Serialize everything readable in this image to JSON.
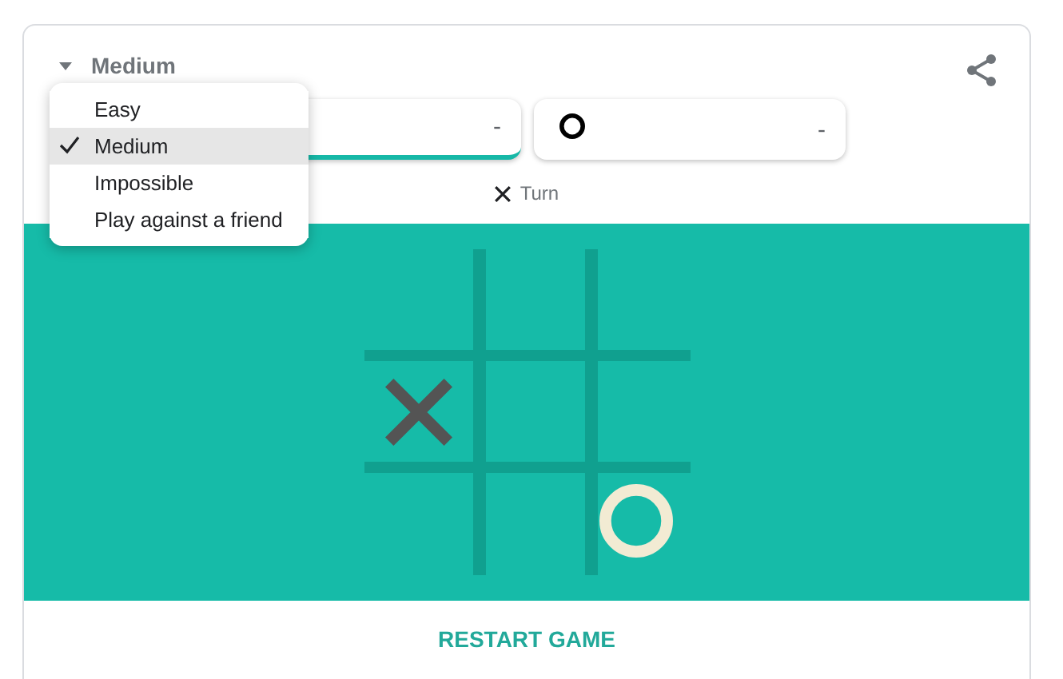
{
  "difficulty": {
    "label": "Medium"
  },
  "menu": [
    {
      "label": "Easy",
      "selected": false
    },
    {
      "label": "Medium",
      "selected": true
    },
    {
      "label": "Impossible",
      "selected": false
    },
    {
      "label": "Play against a friend",
      "selected": false
    }
  ],
  "players": [
    {
      "score": "-",
      "selected": true
    },
    {
      "kind": "o",
      "score": "-",
      "selected": false
    }
  ],
  "turn": {
    "kind": "x",
    "label": "Turn"
  },
  "board": [
    {
      "kind": "empty"
    },
    {
      "kind": "empty"
    },
    {
      "kind": "empty"
    },
    {
      "kind": "x"
    },
    {
      "kind": "empty"
    },
    {
      "kind": "empty"
    },
    {
      "kind": "empty"
    },
    {
      "kind": "empty"
    },
    {
      "kind": "o"
    }
  ],
  "restart": "RESTART GAME"
}
